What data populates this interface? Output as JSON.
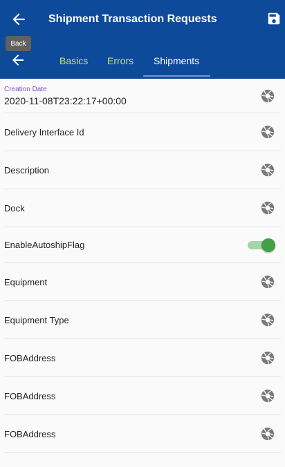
{
  "header": {
    "title": "Shipment Transaction Requests",
    "back_tooltip": "Back"
  },
  "tabs": [
    {
      "label": "Basics"
    },
    {
      "label": "Errors"
    },
    {
      "label": "Shipments",
      "active": true
    }
  ],
  "fields": {
    "creation_date_label": "Creation Date",
    "creation_date_value": "2020-11-08T23:22:17+00:00",
    "rows": [
      {
        "label": "Delivery Interface Id"
      },
      {
        "label": "Description"
      },
      {
        "label": "Dock"
      },
      {
        "label": "EnableAutoshipFlag",
        "toggle": true,
        "toggle_on": true
      },
      {
        "label": "Equipment"
      },
      {
        "label": "Equipment Type"
      },
      {
        "label": "FOBAddress"
      },
      {
        "label": "FOBAddress"
      },
      {
        "label": "FOBAddress"
      }
    ]
  },
  "colors": {
    "appbar": "#0d4a9a",
    "tab_inactive": "#c6e76a",
    "tab_indicator": "#7e8fd8",
    "toggle_on": "#43a047"
  },
  "icons": [
    "arrow-left-icon",
    "save-icon",
    "camera-shutter-icon"
  ]
}
